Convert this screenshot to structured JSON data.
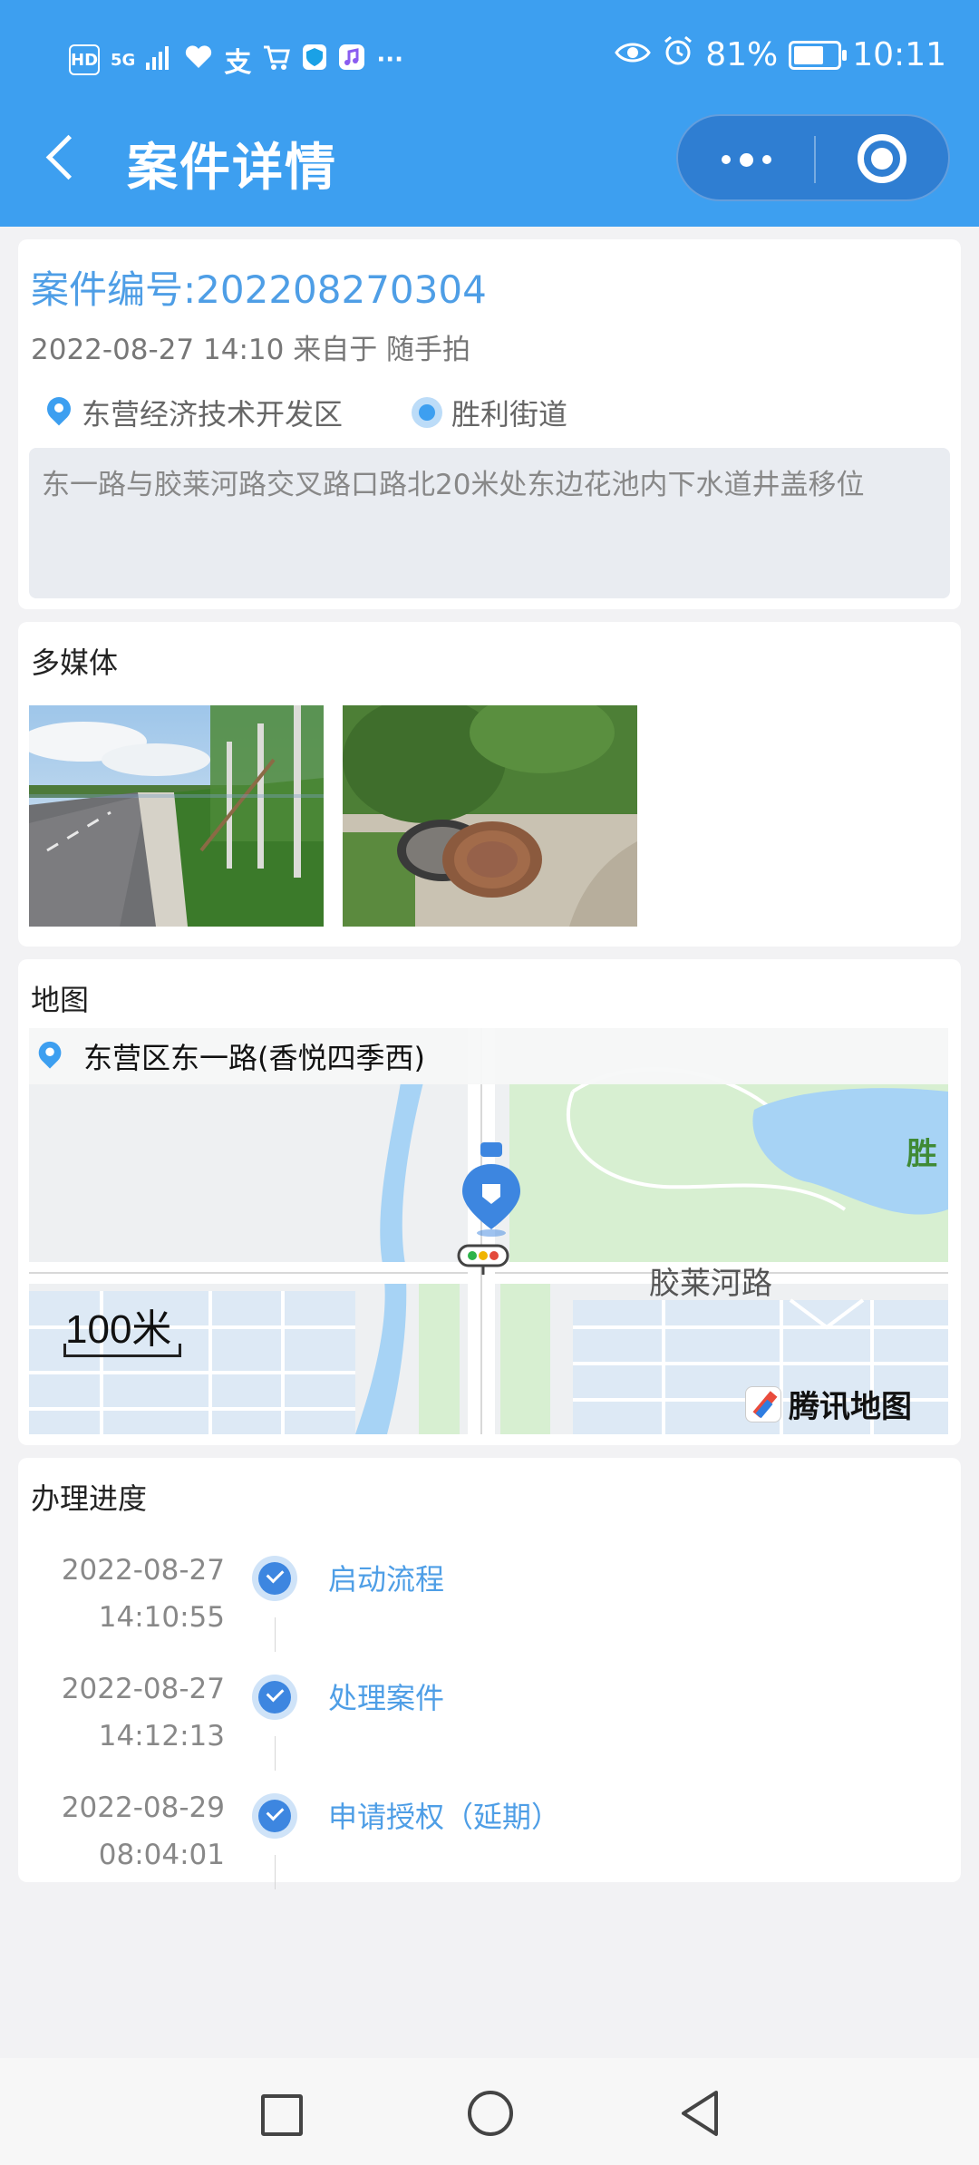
{
  "status_bar": {
    "left_icons": [
      "HD",
      "5G",
      "signal-icon",
      "heart-icon",
      "alipay-icon",
      "cart-icon",
      "shield-icon",
      "music-icon",
      "···"
    ],
    "battery_percent": "81%",
    "battery_level": 0.81,
    "time": "10:11"
  },
  "header": {
    "title": "案件详情",
    "accent_color": "#3d9ff0"
  },
  "case": {
    "number_label": "案件编号:202208270304",
    "meta": "2022-08-27 14:10 来自于 随手拍",
    "district": "东营经济技术开发区",
    "street": "胜利街道",
    "description": "东一路与胶莱河路交叉路口路北20米处东边花池内下水道井盖移位"
  },
  "media": {
    "title": "多媒体",
    "images": [
      "road-photo",
      "manhole-photo"
    ]
  },
  "map": {
    "title": "地图",
    "address": "东营区东一路(香悦四季西)",
    "scale": "100米",
    "road": "胶莱河路",
    "poi_partial": "胜",
    "provider": "腾讯地图"
  },
  "progress": {
    "title": "办理进度",
    "steps": [
      {
        "date": "2022-08-27",
        "time": "14:10:55",
        "label": "启动流程"
      },
      {
        "date": "2022-08-27",
        "time": "14:12:13",
        "label": "处理案件"
      },
      {
        "date": "2022-08-29",
        "time": "08:04:01",
        "label": "申请授权（延期）"
      }
    ]
  }
}
